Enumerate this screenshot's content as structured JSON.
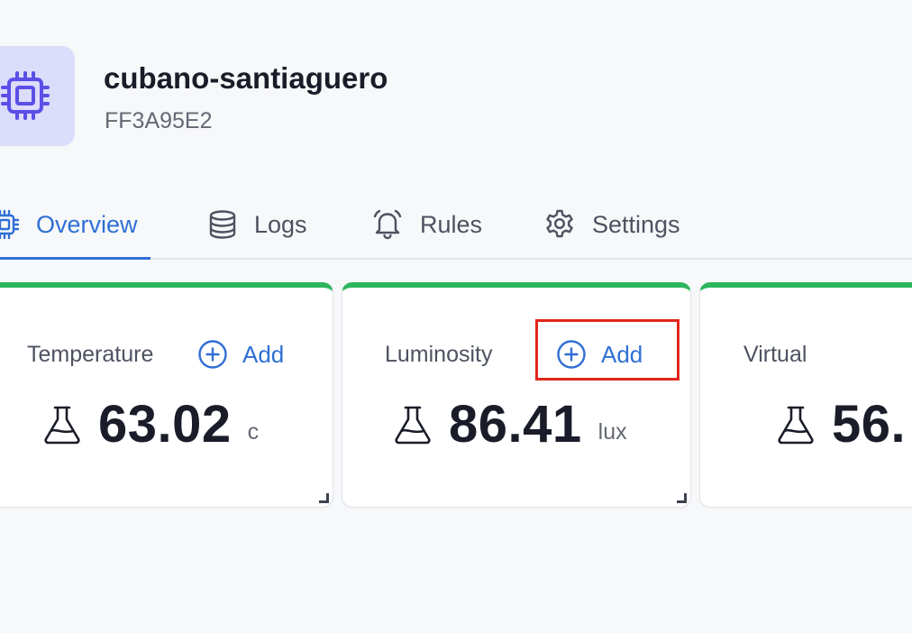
{
  "device": {
    "name": "cubano-santiaguero",
    "id": "FF3A95E2",
    "icon": "chip-icon"
  },
  "tabs": [
    {
      "label": "Overview",
      "icon": "chip-icon",
      "active": true
    },
    {
      "label": "Logs",
      "icon": "database-icon",
      "active": false
    },
    {
      "label": "Rules",
      "icon": "bell-icon",
      "active": false
    },
    {
      "label": "Settings",
      "icon": "gear-icon",
      "active": false
    }
  ],
  "cards": [
    {
      "label": "Temperature",
      "add_label": "Add",
      "value": "63.02",
      "unit": "c",
      "icon": "flask-icon"
    },
    {
      "label": "Luminosity",
      "add_label": "Add",
      "value": "86.41",
      "unit": "lux",
      "icon": "flask-icon"
    },
    {
      "label": "Virtual",
      "value": "56.",
      "icon": "flask-icon"
    }
  ],
  "colors": {
    "accent": "#2f6fd4",
    "card_top_border": "#2db55d",
    "icon_box_bg": "#dcdcfb",
    "icon_purple": "#5b4fe8",
    "highlight": "#e0281c"
  }
}
